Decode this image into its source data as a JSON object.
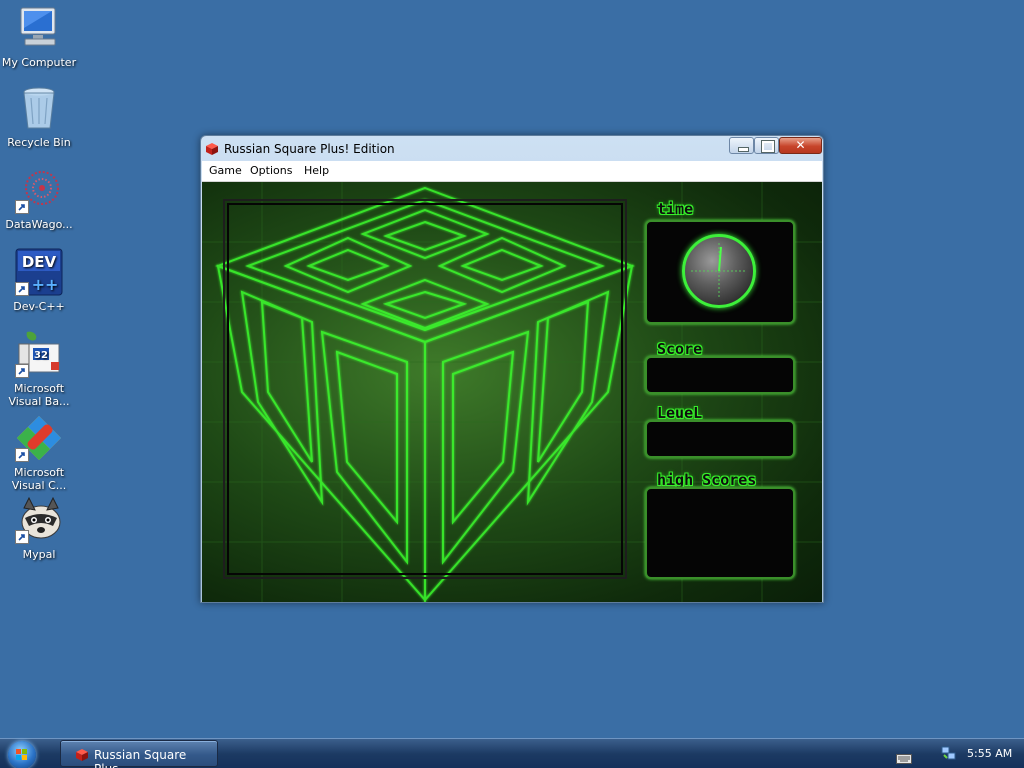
{
  "desktop": {
    "icons": [
      {
        "label": "My Computer",
        "icon": "computer-icon"
      },
      {
        "label": "Recycle Bin",
        "icon": "recycle-bin-icon"
      },
      {
        "label": "DataWago...",
        "icon": "datawagon-icon"
      },
      {
        "label": "Dev-C++",
        "icon": "dev-cpp-icon",
        "badge": "DEV"
      },
      {
        "label": "Microsoft\nVisual Ba...",
        "icon": "visual-basic-icon",
        "badge": "32"
      },
      {
        "label": "Microsoft\nVisual C...",
        "icon": "visual-cpp-icon"
      },
      {
        "label": "Mypal",
        "icon": "mypal-icon"
      }
    ]
  },
  "window": {
    "title": "Russian Square Plus! Edition",
    "menu": [
      "Game",
      "Options",
      "Help"
    ],
    "close_glyph": "✕"
  },
  "game": {
    "labels": {
      "time": "time",
      "score": "Score",
      "level": "LeueL",
      "high_scores": "high Scores"
    },
    "values": {
      "score": "",
      "level": "",
      "high_scores": ""
    }
  },
  "taskbar": {
    "task_label": "Russian Square Plus...",
    "time": "5:55 AM"
  },
  "colors": {
    "desktop": "#3a6ea5",
    "neon_green": "#37f02a"
  }
}
